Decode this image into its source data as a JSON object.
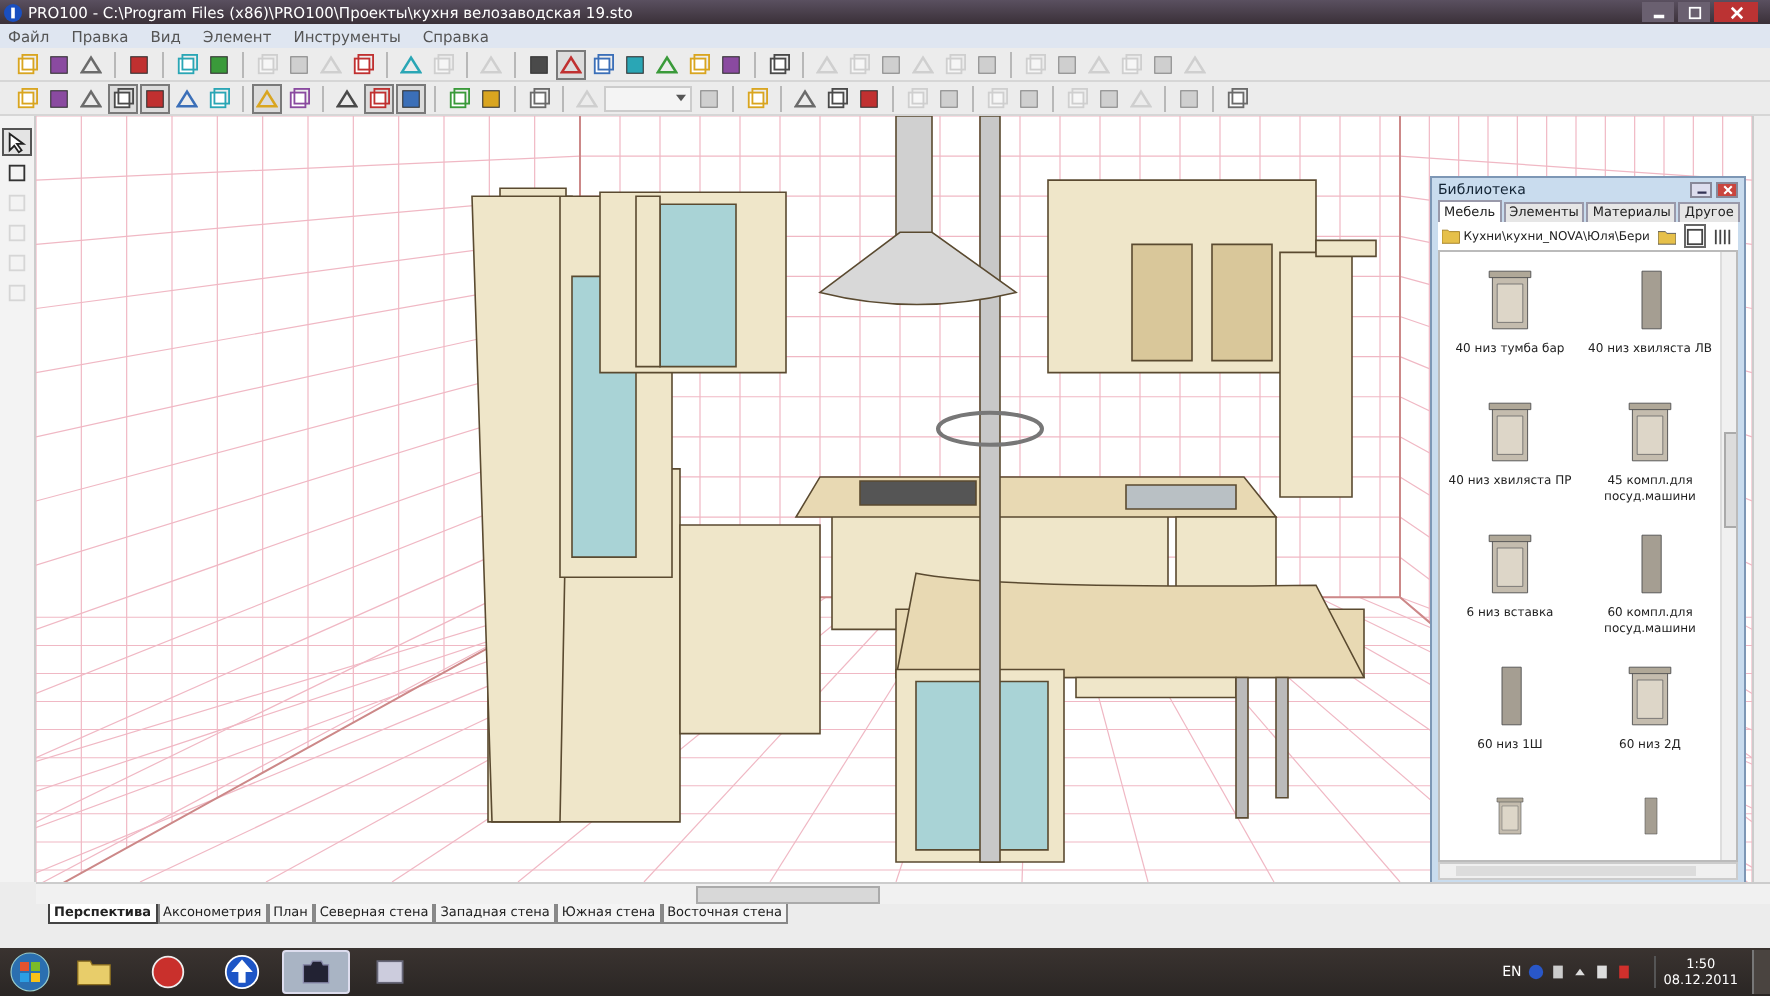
{
  "window": {
    "title": "PRO100 - C:\\Program Files (x86)\\PRO100\\Проекты\\кухня велозаводская 19.sto"
  },
  "menu": [
    "Файл",
    "Правка",
    "Вид",
    "Элемент",
    "Инструменты",
    "Справка"
  ],
  "toolbar_1": [
    {
      "kind": "button",
      "disabled": false,
      "pressed": false
    },
    {
      "kind": "button",
      "disabled": false,
      "pressed": false
    },
    {
      "kind": "button",
      "disabled": false,
      "pressed": false
    },
    {
      "kind": "separator"
    },
    {
      "kind": "button",
      "disabled": false,
      "pressed": false
    },
    {
      "kind": "separator"
    },
    {
      "kind": "button",
      "disabled": false,
      "pressed": false
    },
    {
      "kind": "button",
      "disabled": false,
      "pressed": false
    },
    {
      "kind": "separator"
    },
    {
      "kind": "button",
      "disabled": true,
      "pressed": false
    },
    {
      "kind": "button",
      "disabled": true,
      "pressed": false
    },
    {
      "kind": "button",
      "disabled": true,
      "pressed": false
    },
    {
      "kind": "button",
      "disabled": false,
      "pressed": false
    },
    {
      "kind": "separator"
    },
    {
      "kind": "button",
      "disabled": false,
      "pressed": false
    },
    {
      "kind": "button",
      "disabled": true,
      "pressed": false
    },
    {
      "kind": "separator"
    },
    {
      "kind": "button",
      "disabled": true,
      "pressed": false
    },
    {
      "kind": "separator"
    },
    {
      "kind": "button",
      "disabled": false,
      "pressed": false
    },
    {
      "kind": "button",
      "disabled": false,
      "pressed": true
    },
    {
      "kind": "button",
      "disabled": false,
      "pressed": false
    },
    {
      "kind": "button",
      "disabled": false,
      "pressed": false
    },
    {
      "kind": "button",
      "disabled": false,
      "pressed": false
    },
    {
      "kind": "button",
      "disabled": false,
      "pressed": false
    },
    {
      "kind": "button",
      "disabled": false,
      "pressed": false
    },
    {
      "kind": "separator"
    },
    {
      "kind": "button",
      "disabled": false,
      "pressed": false
    },
    {
      "kind": "separator"
    },
    {
      "kind": "button",
      "disabled": true,
      "pressed": false
    },
    {
      "kind": "button",
      "disabled": true,
      "pressed": false
    },
    {
      "kind": "button",
      "disabled": true,
      "pressed": false
    },
    {
      "kind": "button",
      "disabled": true,
      "pressed": false
    },
    {
      "kind": "button",
      "disabled": true,
      "pressed": false
    },
    {
      "kind": "button",
      "disabled": true,
      "pressed": false
    },
    {
      "kind": "separator"
    },
    {
      "kind": "button",
      "disabled": true,
      "pressed": false
    },
    {
      "kind": "button",
      "disabled": true,
      "pressed": false
    },
    {
      "kind": "button",
      "disabled": true,
      "pressed": false
    },
    {
      "kind": "button",
      "disabled": true,
      "pressed": false
    },
    {
      "kind": "button",
      "disabled": true,
      "pressed": false
    },
    {
      "kind": "button",
      "disabled": true,
      "pressed": false
    }
  ],
  "toolbar_2": [
    {
      "kind": "button",
      "disabled": false,
      "pressed": false
    },
    {
      "kind": "button",
      "disabled": false,
      "pressed": false
    },
    {
      "kind": "button",
      "disabled": false,
      "pressed": false
    },
    {
      "kind": "button",
      "disabled": false,
      "pressed": true
    },
    {
      "kind": "button",
      "disabled": false,
      "pressed": true
    },
    {
      "kind": "button",
      "disabled": false,
      "pressed": false
    },
    {
      "kind": "button",
      "disabled": false,
      "pressed": false
    },
    {
      "kind": "separator"
    },
    {
      "kind": "button",
      "disabled": false,
      "pressed": true
    },
    {
      "kind": "button",
      "disabled": false,
      "pressed": false
    },
    {
      "kind": "separator"
    },
    {
      "kind": "button",
      "disabled": false,
      "pressed": false
    },
    {
      "kind": "button",
      "disabled": false,
      "pressed": true
    },
    {
      "kind": "button",
      "disabled": false,
      "pressed": true
    },
    {
      "kind": "separator"
    },
    {
      "kind": "button",
      "disabled": false,
      "pressed": false
    },
    {
      "kind": "button",
      "disabled": false,
      "pressed": false
    },
    {
      "kind": "separator"
    },
    {
      "kind": "button",
      "disabled": false,
      "pressed": false
    },
    {
      "kind": "separator"
    },
    {
      "kind": "button",
      "disabled": true,
      "pressed": false
    },
    {
      "kind": "combo",
      "disabled": true
    },
    {
      "kind": "button",
      "disabled": true,
      "pressed": false
    },
    {
      "kind": "separator"
    },
    {
      "kind": "button",
      "disabled": false,
      "pressed": false
    },
    {
      "kind": "separator"
    },
    {
      "kind": "button",
      "disabled": false,
      "pressed": false
    },
    {
      "kind": "button",
      "disabled": false,
      "pressed": false
    },
    {
      "kind": "button",
      "disabled": false,
      "pressed": false
    },
    {
      "kind": "separator"
    },
    {
      "kind": "button",
      "disabled": true,
      "pressed": false
    },
    {
      "kind": "button",
      "disabled": true,
      "pressed": false
    },
    {
      "kind": "separator"
    },
    {
      "kind": "button",
      "disabled": true,
      "pressed": false
    },
    {
      "kind": "button",
      "disabled": true,
      "pressed": false
    },
    {
      "kind": "separator"
    },
    {
      "kind": "button",
      "disabled": true,
      "pressed": false
    },
    {
      "kind": "button",
      "disabled": true,
      "pressed": false
    },
    {
      "kind": "button",
      "disabled": true,
      "pressed": false
    },
    {
      "kind": "separator"
    },
    {
      "kind": "button",
      "disabled": true,
      "pressed": false
    },
    {
      "kind": "separator"
    },
    {
      "kind": "button",
      "disabled": false,
      "pressed": false
    }
  ],
  "side_tools": [
    {
      "selected": true,
      "disabled": false
    },
    {
      "selected": false,
      "disabled": false
    },
    {
      "selected": false,
      "disabled": true
    },
    {
      "selected": false,
      "disabled": true
    },
    {
      "selected": false,
      "disabled": true
    },
    {
      "selected": false,
      "disabled": true
    }
  ],
  "library": {
    "title": "Библиотека",
    "tabs": [
      {
        "label": "Мебель",
        "selected": true
      },
      {
        "label": "Элементы",
        "selected": false
      },
      {
        "label": "Материалы",
        "selected": false
      },
      {
        "label": "Другое",
        "selected": false
      }
    ],
    "path": "Кухни\\кухни_NOVA\\Юля\\Бери",
    "items": [
      {
        "kind": "labeled",
        "label": "40 низ тумба бар"
      },
      {
        "kind": "labeled",
        "label": "40 низ хвиляста ЛВ"
      },
      {
        "kind": "labeled",
        "label": "40 низ хвиляста ПР"
      },
      {
        "kind": "labeled",
        "label": "45 компл.для посуд.машини"
      },
      {
        "kind": "labeled",
        "label": "6 низ вставка"
      },
      {
        "kind": "labeled",
        "label": "60 компл.для посуд.машини"
      },
      {
        "kind": "labeled",
        "label": "60 низ 1Ш"
      },
      {
        "kind": "labeled",
        "label": "60 низ 2Д"
      },
      {
        "kind": "thumbnail_only"
      },
      {
        "kind": "thumbnail_only"
      }
    ]
  },
  "view_tabs": [
    {
      "label": "Перспектива",
      "selected": true
    },
    {
      "label": "Аксонометрия",
      "selected": false
    },
    {
      "label": "План",
      "selected": false
    },
    {
      "label": "Северная стена",
      "selected": false
    },
    {
      "label": "Западная стена",
      "selected": false
    },
    {
      "label": "Южная стена",
      "selected": false
    },
    {
      "label": "Восточная стена",
      "selected": false
    }
  ],
  "taskbar": {
    "apps": [
      {
        "selected": false
      },
      {
        "selected": false
      },
      {
        "selected": false
      },
      {
        "selected": true
      },
      {
        "selected": false
      }
    ],
    "language": "EN",
    "time": "1:50",
    "date": "08.12.2011"
  }
}
